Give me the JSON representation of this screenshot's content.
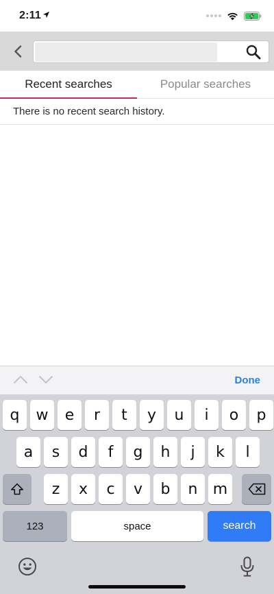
{
  "status_bar": {
    "time": "2:11"
  },
  "search": {
    "value": "",
    "placeholder": ""
  },
  "tabs": [
    {
      "label": "Recent searches",
      "active": true
    },
    {
      "label": "Popular searches",
      "active": false
    }
  ],
  "empty_message": "There is no recent search history.",
  "accessory": {
    "done_label": "Done"
  },
  "keyboard": {
    "row1": [
      "q",
      "w",
      "e",
      "r",
      "t",
      "y",
      "u",
      "i",
      "o",
      "p"
    ],
    "row2": [
      "a",
      "s",
      "d",
      "f",
      "g",
      "h",
      "j",
      "k",
      "l"
    ],
    "row3": [
      "z",
      "x",
      "c",
      "v",
      "b",
      "n",
      "m"
    ],
    "numbers_label": "123",
    "space_label": "space",
    "return_label": "search"
  },
  "colors": {
    "accent": "#c8285a",
    "done": "#2b7fdc",
    "return_key": "#2f7cf6",
    "battery": "#34c759"
  },
  "icons": [
    "location-arrow-icon",
    "signal-dots-icon",
    "wifi-icon",
    "battery-charging-icon",
    "back-chevron-icon",
    "search-icon",
    "chevron-up-icon",
    "chevron-down-icon",
    "shift-icon",
    "backspace-icon",
    "emoji-icon",
    "microphone-icon"
  ]
}
